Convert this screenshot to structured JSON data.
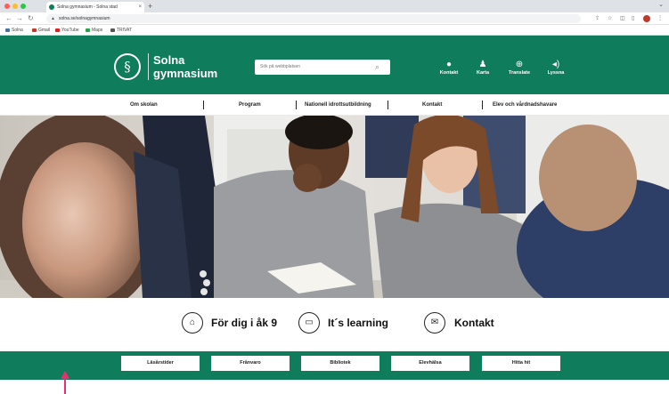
{
  "browser": {
    "tab_title": "Solna gymnasium - Solna stad",
    "tab_close": "×",
    "new_tab": "+",
    "tab_menu": "⌄",
    "url": "solna.se/solnagymnasium",
    "lock_icon": "lock-icon",
    "bookmarks": [
      {
        "label": "Solna",
        "color": "#4a6fa5"
      },
      {
        "label": "Gmail",
        "color": "#c0392b"
      },
      {
        "label": "YouTube",
        "color": "#e02020"
      },
      {
        "label": "Maps",
        "color": "#2e9e4f"
      },
      {
        "label": "TRIVAT",
        "color": "#555555"
      }
    ]
  },
  "site": {
    "brand_color": "#0f7d5c",
    "logo_line1": "Solna",
    "logo_line2": "gymnasium",
    "search_placeholder": "Sök på webbplatsen",
    "utilities": [
      {
        "icon": "chat-icon",
        "glyph": "●",
        "label": "Kontakt"
      },
      {
        "icon": "people-icon",
        "glyph": "♟",
        "label": "Karta"
      },
      {
        "icon": "globe-icon",
        "glyph": "⊕",
        "label": "Translate"
      },
      {
        "icon": "speaker-icon",
        "glyph": "◂)",
        "label": "Lyssna"
      }
    ]
  },
  "nav": [
    "Om skolan",
    "Program",
    "Nationell idrottsutbildning",
    "Kontakt",
    "Elev och vårdnadshavare"
  ],
  "hero": {
    "image_alt": "hero-photo-students"
  },
  "quicklinks": [
    {
      "icon": "building-icon",
      "glyph": "⌂",
      "label": "För dig i åk 9"
    },
    {
      "icon": "monitor-icon",
      "glyph": "▭",
      "label": "It´s learning"
    },
    {
      "icon": "envelope-icon",
      "glyph": "✉",
      "label": "Kontakt"
    }
  ],
  "bottom_buttons": [
    "Läsårstider",
    "Frånvaro",
    "Bibliotek",
    "Elevhälsa",
    "Hitta hit"
  ],
  "annotation": {
    "color": "#e8306e"
  }
}
